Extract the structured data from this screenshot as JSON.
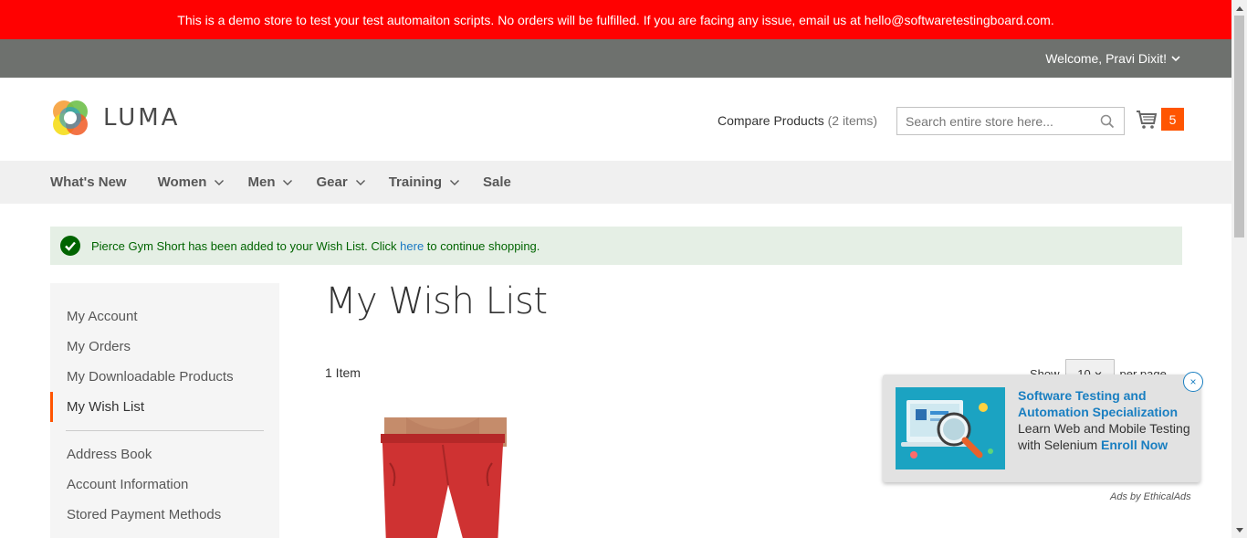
{
  "banner": {
    "text": "This is a demo store to test your test automaiton scripts. No orders will be fulfilled. If you are facing any issue, email us at hello@softwaretestingboard.com."
  },
  "top_bar": {
    "welcome": "Welcome, Pravi Dixit!"
  },
  "header": {
    "logo_text": "LUMA",
    "compare_label": "Compare Products",
    "compare_count": "(2 items)",
    "search_placeholder": "Search entire store here...",
    "cart_count": "5"
  },
  "nav": {
    "items": [
      {
        "label": "What's New",
        "has_dropdown": false
      },
      {
        "label": "Women",
        "has_dropdown": true
      },
      {
        "label": "Men",
        "has_dropdown": true
      },
      {
        "label": "Gear",
        "has_dropdown": true
      },
      {
        "label": "Training",
        "has_dropdown": true
      },
      {
        "label": "Sale",
        "has_dropdown": false
      }
    ]
  },
  "message": {
    "before": "Pierce Gym Short has been added to your Wish List. Click ",
    "link": "here",
    "after": " to continue shopping."
  },
  "sidebar": {
    "items": [
      {
        "label": "My Account"
      },
      {
        "label": "My Orders"
      },
      {
        "label": "My Downloadable Products"
      },
      {
        "label": "My Wish List",
        "active": true
      },
      {
        "label": "Address Book"
      },
      {
        "label": "Account Information"
      },
      {
        "label": "Stored Payment Methods"
      }
    ]
  },
  "main": {
    "title": "My Wish List",
    "items_count": "1 Item",
    "show_label": "Show",
    "limit_value": "10",
    "per_page_label": "per page"
  },
  "ad": {
    "title": "Software Testing and Automation Specialization",
    "body": "Learn Web and Mobile Testing with Selenium",
    "cta": "Enroll Now",
    "attribution": "Ads by EthicalAds",
    "close": "×"
  },
  "colors": {
    "banner_bg": "#ff0101",
    "top_bar_bg": "#6e716e",
    "accent": "#ff5501",
    "link": "#1979c3",
    "success_bg": "#e5efe5"
  }
}
